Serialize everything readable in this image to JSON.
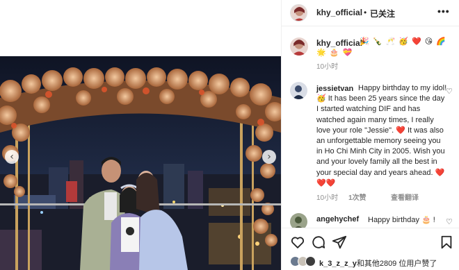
{
  "post": {
    "author": "khy_official",
    "follow_dot": "•",
    "follow_status": "已关注",
    "more_icon": "more-horizontal-icon",
    "nav": {
      "prev": "‹",
      "next": "›"
    }
  },
  "caption": {
    "username": "khy_official",
    "emoji_line_1": "🎉 🍾 🥂 🥳 ❤️ 😘 🌈",
    "emoji_line_2": "🌟 🎂 💝",
    "time": "10小时"
  },
  "comments": [
    {
      "username": "jessietvan",
      "text": "Happy birthday to my idol!🥳  It has been 25 years since the day I started watching DIF and has watched again many times, I really love your role \"Jessie\". ❤️  It was also an unforgettable memory seeing you in Ho Chi Minh City in 2005. Wish you and your lovely family all the best in your special day and years ahead. ❤️❤️❤️",
      "time": "10小时",
      "likes": "1次赞",
      "reply": "查看翻译"
    },
    {
      "username": "angehychef",
      "text": "Happy birthday 🎂 !"
    }
  ],
  "likes": {
    "users": "k_3_z_z_y",
    "suffix": "和其他2809 位用户赞了"
  },
  "colors": {
    "text": "#262626",
    "secondary": "#8e8e8e",
    "divider": "#efefef",
    "heart_red": "#ed4956"
  }
}
